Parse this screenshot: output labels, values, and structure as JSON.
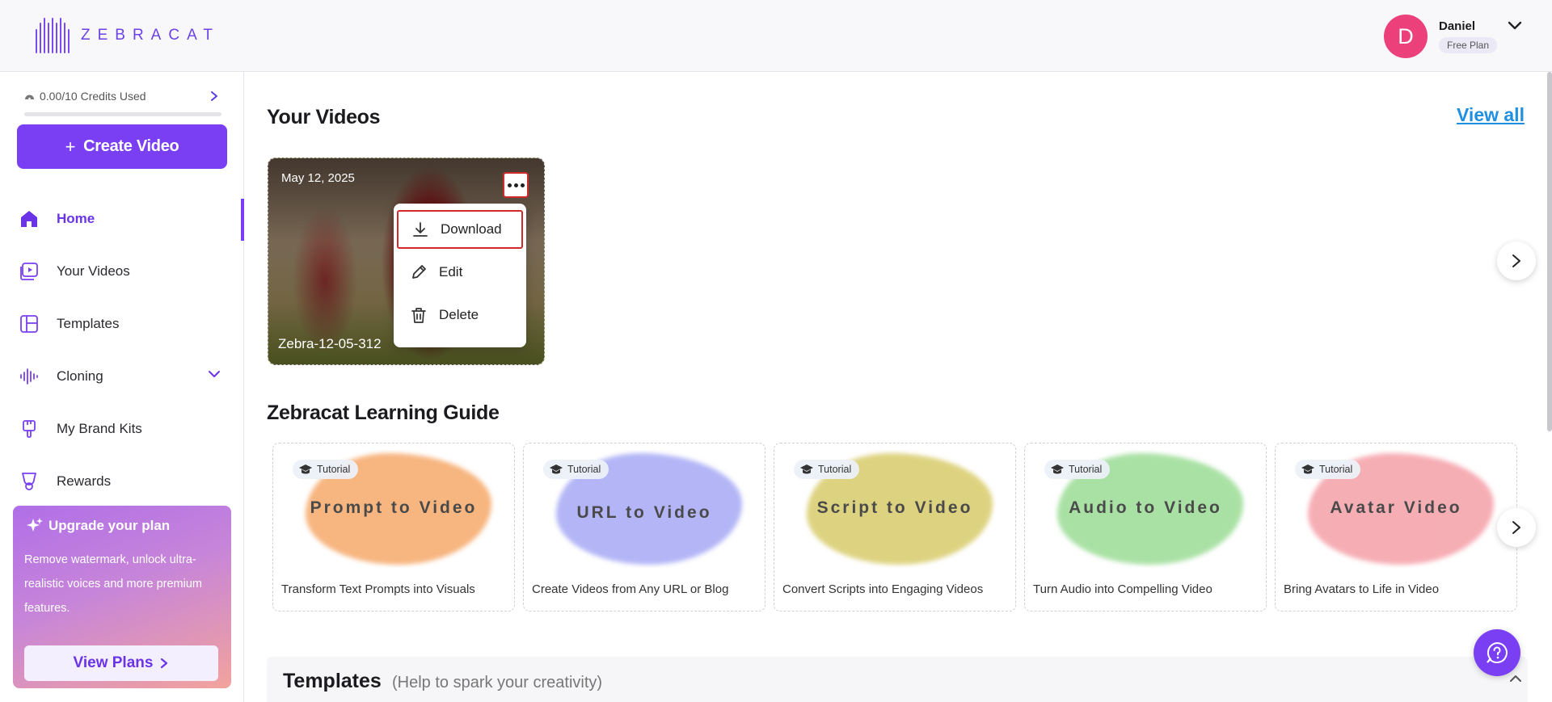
{
  "brand": {
    "name": "ZEBRACAT",
    "accent": "#7a3ff2"
  },
  "user": {
    "initial": "D",
    "name": "Daniel",
    "plan": "Free Plan",
    "avatar_color": "#ec407a"
  },
  "sidebar": {
    "credits": "0.00/10 Credits Used",
    "credits_fraction": 0.0,
    "create_button": "Create Video",
    "items": [
      {
        "label": "Home",
        "icon": "home-icon",
        "active": true
      },
      {
        "label": "Your Videos",
        "icon": "video-library-icon",
        "active": false
      },
      {
        "label": "Templates",
        "icon": "templates-icon",
        "active": false
      },
      {
        "label": "Cloning",
        "icon": "waveform-icon",
        "active": false,
        "expandable": true
      },
      {
        "label": "My Brand Kits",
        "icon": "brush-icon",
        "active": false
      },
      {
        "label": "Rewards",
        "icon": "trophy-icon",
        "active": false
      }
    ],
    "upgrade": {
      "title": "Upgrade your plan",
      "description": "Remove watermark, unlock ultra-realistic voices and more premium features.",
      "button": "View Plans"
    }
  },
  "main": {
    "videos_title": "Your Videos",
    "view_all": "View all",
    "videos": [
      {
        "date": "May 12, 2025",
        "name": "Zebra-12-05-312"
      }
    ],
    "menu": [
      {
        "label": "Download",
        "icon": "download-icon"
      },
      {
        "label": "Edit",
        "icon": "pencil-icon"
      },
      {
        "label": "Delete",
        "icon": "trash-icon"
      }
    ],
    "guide_title": "Zebracat Learning Guide",
    "guides": [
      {
        "tag": "Tutorial",
        "title": "Prompt to Video",
        "desc": "Transform Text Prompts into Visuals",
        "color": "#f6a96a"
      },
      {
        "tag": "Tutorial",
        "title": "URL to Video",
        "desc": "Create Videos from Any URL or Blog",
        "color": "#a6a9f5"
      },
      {
        "tag": "Tutorial",
        "title": "Script to Video",
        "desc": "Convert Scripts into Engaging Videos",
        "color": "#d8cb6a"
      },
      {
        "tag": "Tutorial",
        "title": "Audio to Video",
        "desc": "Turn Audio into Compelling Video",
        "color": "#9bdc95"
      },
      {
        "tag": "Tutorial",
        "title": "Avatar Video",
        "desc": "Bring Avatars to Life in Video",
        "color": "#f5a0a8"
      }
    ],
    "templates_title": "Templates",
    "templates_subtitle": "(Help to spark your creativity)"
  }
}
